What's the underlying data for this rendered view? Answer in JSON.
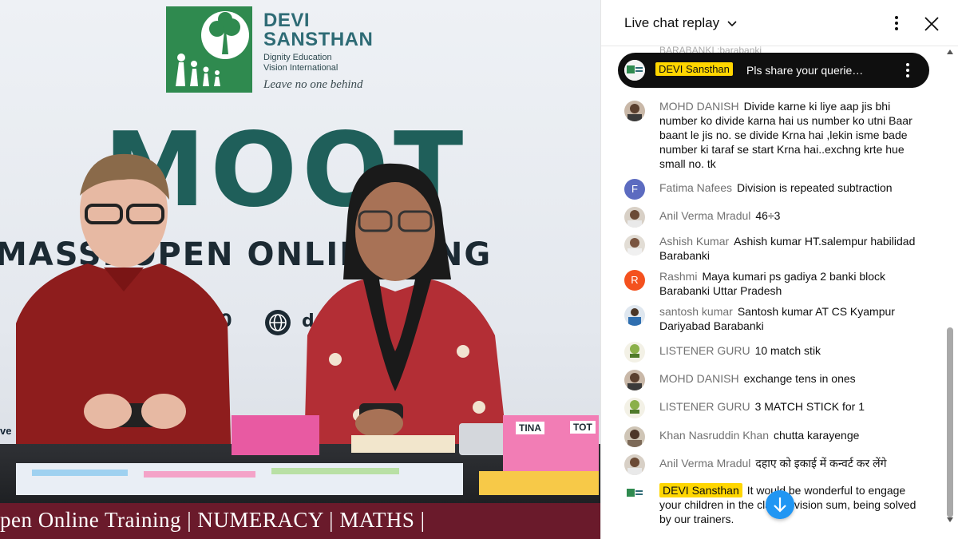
{
  "video": {
    "logo": {
      "title_line1": "DEVI",
      "title_line2": "SANSTHAN",
      "subtitle_line1": "Dignity Education",
      "subtitle_line2": "Vision International",
      "tagline": "Leave no one behind"
    },
    "banner_big": "MOOT",
    "banner_sub": "MASSI  OPEN ONLIN   INING",
    "contact_fragment": "00",
    "web_fragment": "d",
    "ticker": "pen Online Training | NUMERACY | MATHS |",
    "props": {
      "sign_left": "ve",
      "card_tina": "TINA",
      "card_tot": "TOT"
    }
  },
  "chat": {
    "header_title": "Live chat replay",
    "pinned": {
      "author": "DEVI Sansthan",
      "message": "Pls share your querie…"
    },
    "top_cut_text": "BARABANKI :barabanki",
    "messages": [
      {
        "author": "MOHD DANISH",
        "text": "Divide karne ki liye aap jis bhi number ko divide karna hai us number ko utni Baar baant le jis no. se divide Krna hai ,lekin isme bade number ki taraf se start Krna hai..exchng krte hue small no. tk",
        "avatar": "photo",
        "owner": false
      },
      {
        "author": "Fatima Nafees",
        "text": "Division is repeated subtraction",
        "avatar": "F",
        "owner": false
      },
      {
        "author": "Anil Verma Mradul",
        "text": "46÷3",
        "avatar": "photo",
        "owner": false
      },
      {
        "author": "Ashish Kumar",
        "text": "Ashish kumar HT.salempur habilidad Barabanki",
        "avatar": "photo",
        "owner": false
      },
      {
        "author": "Rashmi",
        "text": "Maya kumari ps gadiya 2 banki block Barabanki Uttar Pradesh",
        "avatar": "R",
        "owner": false
      },
      {
        "author": "santosh kumar",
        "text": "Santosh kumar AT CS Kyampur Dariyabad Barabanki",
        "avatar": "photo",
        "owner": false
      },
      {
        "author": "LISTENER GURU",
        "text": "10 match stik",
        "avatar": "logo",
        "owner": false
      },
      {
        "author": "MOHD DANISH",
        "text": "exchange tens in ones",
        "avatar": "photo",
        "owner": false
      },
      {
        "author": "LISTENER GURU",
        "text": "3 MATCH STICK for 1",
        "avatar": "logo",
        "owner": false
      },
      {
        "author": "Khan Nasruddin Khan",
        "text": "chutta karayenge",
        "avatar": "photo",
        "owner": false
      },
      {
        "author": "Anil Verma Mradul",
        "text": "दहाए को इकाई में कन्वर्ट कर लेंगे",
        "avatar": "photo",
        "owner": false
      },
      {
        "author": "DEVI Sansthan",
        "text": "It would be wonderful to engage your children in the class division sum, being solved by our trainers.",
        "avatar": "org",
        "owner": true
      }
    ]
  },
  "colors": {
    "owner_badge": "#ffd600",
    "author_gray": "#717171",
    "avatar_f": "#5c6bc0",
    "avatar_r": "#f4511e",
    "jump_button": "#2196f3",
    "ticker_band": "#6a1a2b",
    "moot_text": "#1f5f5a"
  },
  "icons": {
    "chevron": "chevron-down-icon",
    "menu": "more-vert-icon",
    "close": "close-icon",
    "jump": "arrow-down-icon",
    "globe": "globe-icon"
  }
}
